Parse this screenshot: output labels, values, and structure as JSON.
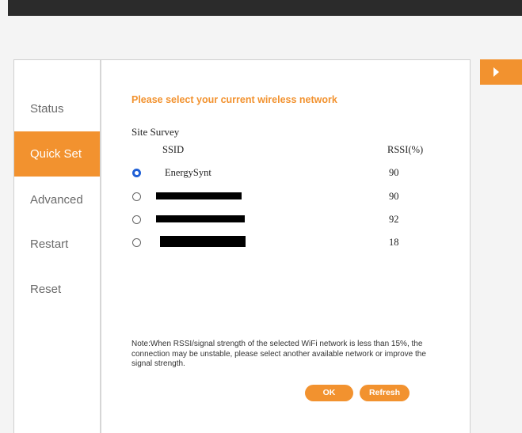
{
  "sidebar": {
    "items": [
      {
        "label": "Status",
        "active": false
      },
      {
        "label": "Quick Set",
        "active": true
      },
      {
        "label": "Advanced",
        "active": false
      },
      {
        "label": "Restart",
        "active": false
      },
      {
        "label": "Reset",
        "active": false
      }
    ]
  },
  "main": {
    "heading": "Please select your current wireless network",
    "section_label": "Site Survey",
    "table": {
      "headers": {
        "ssid": "SSID",
        "rssi": "RSSI(%)"
      },
      "rows": [
        {
          "ssid": "EnergySynt",
          "rssi": "90",
          "selected": true,
          "redacted": false
        },
        {
          "ssid": "",
          "rssi": "90",
          "selected": false,
          "redacted": true
        },
        {
          "ssid": "",
          "rssi": "92",
          "selected": false,
          "redacted": true
        },
        {
          "ssid": "",
          "rssi": "18",
          "selected": false,
          "redacted": true
        }
      ]
    },
    "note": "Note:When RSSI/signal strength of the selected WiFi network is less than 15%, the connection may be unstable, please select another available network or improve the signal strength.",
    "buttons": {
      "ok": "OK",
      "refresh": "Refresh"
    }
  },
  "colors": {
    "accent": "#f2922f",
    "radio_selected": "#1f5fd6",
    "topbar": "#2b2b2b"
  },
  "icons": {
    "side_tab": "play-arrow-icon"
  }
}
